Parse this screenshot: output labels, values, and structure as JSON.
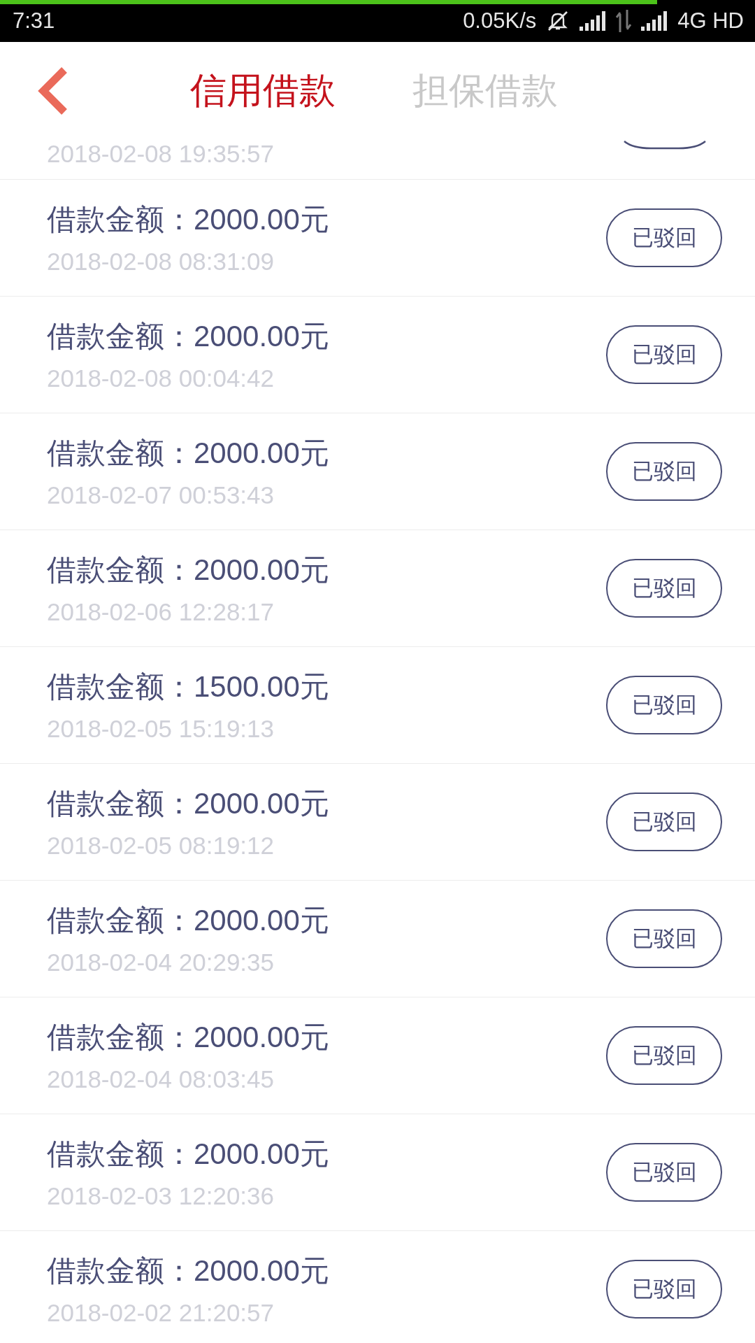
{
  "status_bar": {
    "time": "7:31",
    "network_speed": "0.05K/s",
    "network_type": "4G HD"
  },
  "load_progress": {
    "level": 0.87
  },
  "tabs": [
    {
      "label": "信用借款",
      "selected": true
    },
    {
      "label": "担保借款",
      "selected": false
    }
  ],
  "records": [
    {
      "kind": "partial",
      "date": "2018-02-08 19:35:57"
    },
    {
      "kind": "full",
      "amount": "借款金额：2000.00元",
      "date": "2018-02-08 08:31:09",
      "status": "已驳回"
    },
    {
      "kind": "full",
      "amount": "借款金额：2000.00元",
      "date": "2018-02-08 00:04:42",
      "status": "已驳回"
    },
    {
      "kind": "full",
      "amount": "借款金额：2000.00元",
      "date": "2018-02-07 00:53:43",
      "status": "已驳回"
    },
    {
      "kind": "full",
      "amount": "借款金额：2000.00元",
      "date": "2018-02-06 12:28:17",
      "status": "已驳回"
    },
    {
      "kind": "full",
      "amount": "借款金额：1500.00元",
      "date": "2018-02-05 15:19:13",
      "status": "已驳回"
    },
    {
      "kind": "full",
      "amount": "借款金额：2000.00元",
      "date": "2018-02-05 08:19:12",
      "status": "已驳回"
    },
    {
      "kind": "full",
      "amount": "借款金额：2000.00元",
      "date": "2018-02-04 20:29:35",
      "status": "已驳回"
    },
    {
      "kind": "full",
      "amount": "借款金额：2000.00元",
      "date": "2018-02-04 08:03:45",
      "status": "已驳回"
    },
    {
      "kind": "full",
      "amount": "借款金额：2000.00元",
      "date": "2018-02-03 12:20:36",
      "status": "已驳回"
    },
    {
      "kind": "full",
      "amount": "借款金额：2000.00元",
      "date": "2018-02-02 21:20:57",
      "status": "已驳回"
    }
  ]
}
